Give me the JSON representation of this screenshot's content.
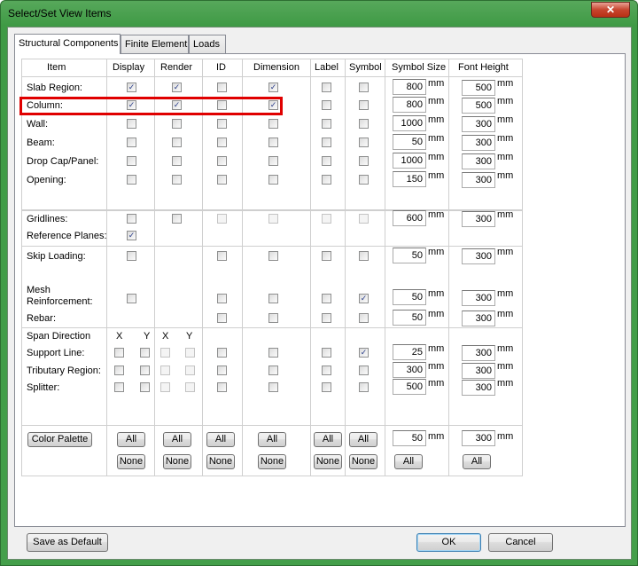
{
  "window": {
    "title": "Select/Set View Items",
    "close_glyph": "✕"
  },
  "tabs": [
    "Structural Components",
    "Finite Element",
    "Loads"
  ],
  "headers": [
    "Item",
    "Display",
    "Render",
    "ID",
    "Dimension",
    "Label",
    "Symbol",
    "Symbol Size",
    "Font Height"
  ],
  "unit": "mm",
  "rows": [
    {
      "label": "Slab Region:",
      "checks": [
        "c",
        "c",
        "u",
        null,
        "c",
        "u",
        "u"
      ],
      "symbol_size": "800",
      "font_height": "500"
    },
    {
      "label": "Column:",
      "checks": [
        "c",
        "c",
        "u",
        null,
        "c",
        "u",
        "u"
      ],
      "symbol_size": "800",
      "font_height": "500"
    },
    {
      "label": "Wall:",
      "checks": [
        "u",
        "u",
        "u",
        null,
        "u",
        "u",
        "u"
      ],
      "symbol_size": "1000",
      "font_height": "300"
    },
    {
      "label": "Beam:",
      "checks": [
        "u",
        "u",
        "u",
        null,
        "u",
        "u",
        "u"
      ],
      "symbol_size": "50",
      "font_height": "300"
    },
    {
      "label": "Drop Cap/Panel:",
      "checks": [
        "u",
        "u",
        "u",
        null,
        "u",
        "u",
        "u"
      ],
      "symbol_size": "1000",
      "font_height": "300"
    },
    {
      "label": "Opening:",
      "checks": [
        "u",
        "u",
        "u",
        null,
        "u",
        "u",
        "u"
      ],
      "symbol_size": "150",
      "font_height": "300"
    },
    {
      "label": "Gridlines:",
      "checks": [
        "u",
        "u",
        "d",
        null,
        "d",
        "d",
        "d"
      ],
      "symbol_size": "600",
      "font_height": "300"
    },
    {
      "label": "Reference Planes:",
      "checks": [
        "c",
        null,
        null,
        null,
        null,
        null,
        null
      ],
      "symbol_size": null,
      "font_height": null
    },
    {
      "label": "Skip Loading:",
      "checks": [
        "u",
        null,
        "u",
        null,
        "u",
        "u",
        "u"
      ],
      "symbol_size": "50",
      "font_height": "300"
    },
    {
      "label": "Mesh\nReinforcement:",
      "checks": [
        "u",
        null,
        "u",
        null,
        "u",
        "u",
        "c"
      ],
      "symbol_size": "50",
      "font_height": "300"
    },
    {
      "label": "Rebar:",
      "checks": [
        null,
        null,
        "u",
        null,
        "u",
        "u",
        "u"
      ],
      "symbol_size": "50",
      "font_height": "300"
    },
    {
      "label": "Span Direction",
      "checks": [],
      "symbol_size": null,
      "font_height": null
    },
    {
      "label": "Support Line:",
      "checks": [
        "u",
        "u",
        "d",
        "d",
        "u",
        "u",
        "c"
      ],
      "symbol_size": "25",
      "font_height": "300"
    },
    {
      "label": "Tributary Region:",
      "checks": [
        "u",
        "u",
        "d",
        "d",
        "u",
        "u",
        "u"
      ],
      "symbol_size": "300",
      "font_height": "300"
    },
    {
      "label": "Splitter:",
      "checks": [
        "u",
        "u",
        "d",
        "d",
        "u",
        "u",
        "u"
      ],
      "symbol_size": "500",
      "font_height": "300"
    }
  ],
  "span_xy": [
    "X",
    "Y",
    "X",
    "Y"
  ],
  "buttons": {
    "color_palette": "Color Palette",
    "all": "All",
    "none": "None",
    "default_symbol_size": "50",
    "default_font_height": "300",
    "save_default": "Save as Default",
    "ok": "OK",
    "cancel": "Cancel"
  }
}
